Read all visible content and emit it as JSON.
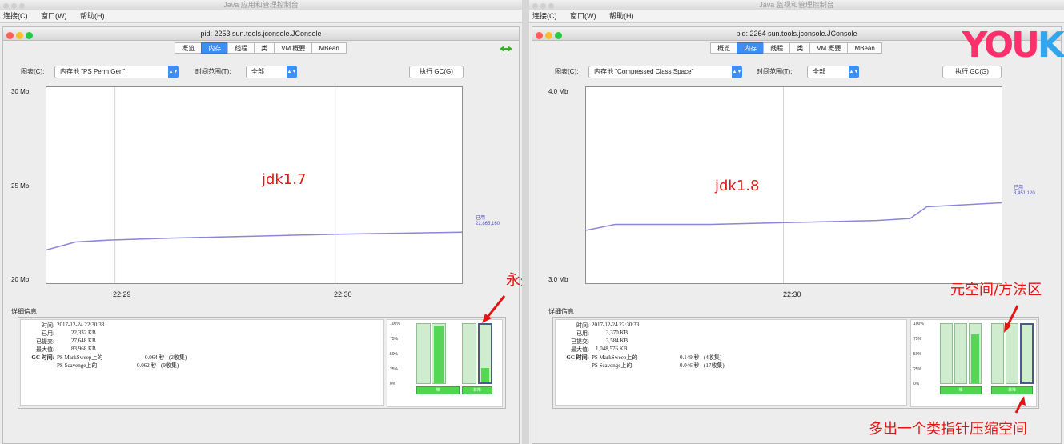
{
  "windows": {
    "left": {
      "app_title": "Java 应用和管理控制台",
      "menu": [
        "连接(C)",
        "窗口(W)",
        "帮助(H)"
      ],
      "inner_title": "pid: 2253 sun.tools.jconsole.JConsole",
      "tabs": [
        "概览",
        "内存",
        "线程",
        "类",
        "VM 概要",
        "MBean"
      ],
      "active_tab": "内存",
      "chart_label": "图表(C):",
      "chart_select": "内存池 \"PS Perm Gen\"",
      "range_label": "时间范围(T):",
      "range_select": "全部",
      "gc_button": "执行 GC(G)",
      "annotation": "jdk1.7",
      "arrow_note": "永久代",
      "details_title": "详细信息",
      "details": {
        "time_k": "时间:",
        "time_v": "2017-12-24 22:30:33",
        "used_k": "已用:",
        "used_v": "22,332 KB",
        "committed_k": "已提交:",
        "committed_v": "27,648 KB",
        "max_k": "最大值:",
        "max_v": "83,968 KB",
        "gc_k": "GC 时间:",
        "gc1_name": "PS MarkSweep上的",
        "gc1_time": "0.064 秒",
        "gc1_count": "(2收集)",
        "gc2_name": "PS Scavenge上的",
        "gc2_time": "0.062 秒",
        "gc2_count": "(9收集)"
      },
      "bar_labels": [
        "堆",
        "非堆"
      ],
      "pct_labels": [
        "100%",
        "75%",
        "50%",
        "25%",
        "0%"
      ],
      "legend_name": "已用",
      "legend_value": "22,865,160"
    },
    "right": {
      "app_title": "Java 监视和管理控制台",
      "menu": [
        "连接(C)",
        "窗口(W)",
        "帮助(H)"
      ],
      "inner_title": "pid: 2264 sun.tools.jconsole.JConsole",
      "tabs": [
        "概览",
        "内存",
        "线程",
        "类",
        "VM 概要",
        "MBean"
      ],
      "active_tab": "内存",
      "chart_label": "图表(C):",
      "chart_select": "内存池 \"Compressed Class Space\"",
      "range_label": "时间范围(T):",
      "range_select": "全部",
      "gc_button": "执行 GC(G)",
      "annotation": "jdk1.8",
      "arrow_note": "元空间/方法区",
      "bottom_note": "多出一个类指针压缩空间",
      "details_title": "详细信息",
      "details": {
        "time_k": "时间:",
        "time_v": "2017-12-24 22:30:33",
        "used_k": "已用:",
        "used_v": "3,370 KB",
        "committed_k": "已提交:",
        "committed_v": "3,584 KB",
        "max_k": "最大值:",
        "max_v": "1,048,576 KB",
        "gc_k": "GC 时间:",
        "gc1_name": "PS MarkSweep上的",
        "gc1_time": "0.149 秒",
        "gc1_count": "(4收集)",
        "gc2_name": "PS Scavenge上的",
        "gc2_time": "0.046 秒",
        "gc2_count": "(17收集)"
      },
      "bar_labels": [
        "堆",
        "非堆"
      ],
      "pct_labels": [
        "100%",
        "75%",
        "50%",
        "25%",
        "0%"
      ],
      "legend_name": "已用",
      "legend_value": "3,451,120"
    }
  },
  "logo": {
    "text_main": "YOU",
    "text_accent": "K",
    "color_main": "#ff2f6b",
    "color_accent": "#2fa6ee"
  },
  "colors": {
    "accent": "#3c8ef3",
    "line": "#8a86d8",
    "annotation": "#e31414",
    "bar_green": "#55d655"
  },
  "chart_data": [
    {
      "type": "line",
      "title": "",
      "yticks": [
        "30 Mb",
        "25 Mb",
        "20 Mb"
      ],
      "xticks": [
        "22:29",
        "22:30"
      ],
      "ylim": [
        20,
        30
      ],
      "series": [
        {
          "name": "已用",
          "x": [
            0,
            0.07,
            0.15,
            0.3,
            0.5,
            0.7,
            1.0
          ],
          "values": [
            21.7,
            22.1,
            22.2,
            22.3,
            22.4,
            22.5,
            22.6
          ]
        }
      ]
    },
    {
      "type": "line",
      "title": "",
      "yticks": [
        "4.0 Mb",
        "3.0 Mb"
      ],
      "xticks": [
        "22:30"
      ],
      "ylim": [
        3.0,
        4.0
      ],
      "series": [
        {
          "name": "已用",
          "x": [
            0,
            0.07,
            0.3,
            0.5,
            0.7,
            0.78,
            0.82,
            1.0
          ],
          "values": [
            3.27,
            3.3,
            3.3,
            3.31,
            3.32,
            3.33,
            3.39,
            3.41
          ]
        }
      ]
    }
  ],
  "bar_fills": {
    "left": [
      0,
      0.96,
      0,
      0.25
    ],
    "right": [
      0,
      0.82,
      0,
      0.02
    ]
  }
}
